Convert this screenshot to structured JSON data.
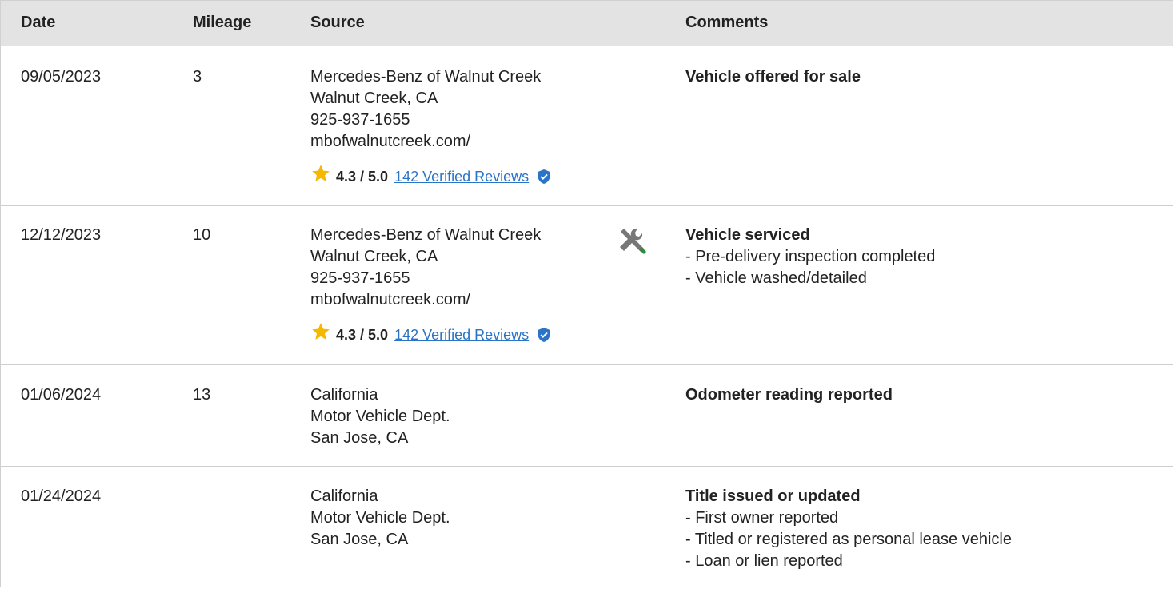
{
  "header": {
    "date": "Date",
    "mileage": "Mileage",
    "source": "Source",
    "comments": "Comments"
  },
  "rows": [
    {
      "date": "09/05/2023",
      "mileage": "3",
      "source": [
        "Mercedes-Benz of Walnut Creek",
        "Walnut Creek, CA",
        "925-937-1655",
        "mbofwalnutcreek.com/"
      ],
      "rating": {
        "score": "4.3 / 5.0",
        "reviews": "142 Verified Reviews"
      },
      "comment_title": "Vehicle offered for sale",
      "comment_items": []
    },
    {
      "date": "12/12/2023",
      "mileage": "10",
      "source": [
        "Mercedes-Benz of Walnut Creek",
        "Walnut Creek, CA",
        "925-937-1655",
        "mbofwalnutcreek.com/"
      ],
      "rating": {
        "score": "4.3 / 5.0",
        "reviews": "142 Verified Reviews"
      },
      "icon": "service-tools-icon",
      "comment_title": "Vehicle serviced",
      "comment_items": [
        "- Pre-delivery inspection completed",
        "- Vehicle washed/detailed"
      ]
    },
    {
      "date": "01/06/2024",
      "mileage": "13",
      "source": [
        "California",
        "Motor Vehicle Dept.",
        "San Jose, CA"
      ],
      "comment_title": "Odometer reading reported",
      "comment_items": []
    },
    {
      "date": "01/24/2024",
      "mileage": "",
      "source": [
        "California",
        "Motor Vehicle Dept.",
        "San Jose, CA"
      ],
      "comment_title": "Title issued or updated",
      "comment_items": [
        "- First owner reported",
        "- Titled or registered as personal lease vehicle",
        "- Loan or lien reported"
      ]
    }
  ],
  "colors": {
    "header_bg": "#e3e3e3",
    "link": "#2a74c8",
    "star": "#f5b800",
    "shield": "#2a74c8",
    "tool_green": "#2e8b3a",
    "tool_gray": "#777777"
  }
}
